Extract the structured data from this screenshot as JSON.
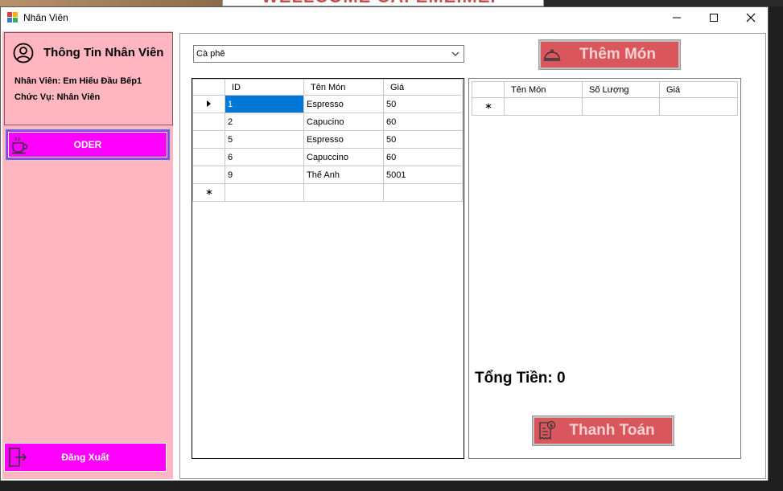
{
  "background_banner": "WELLCOME CAFEMEIMEI",
  "window": {
    "title": "Nhân Viên"
  },
  "sidebar": {
    "info_title": "Thông Tin Nhân Viên",
    "employee_line": "Nhân Viên: Em Hiếu Đầu Bếp1",
    "role_line": "Chức Vụ: Nhân Viên",
    "oder_label": "ODER",
    "logout_label": "Đăng Xuất"
  },
  "main": {
    "category_value": "Cà phê",
    "add_button_label": "Thêm Món",
    "menu_grid": {
      "columns": [
        "ID",
        "Tên Món",
        "Giá"
      ],
      "rows": [
        {
          "id": "1",
          "name": "Espresso",
          "price": "50"
        },
        {
          "id": "2",
          "name": "Capucino",
          "price": "60"
        },
        {
          "id": "5",
          "name": "Espresso",
          "price": "50"
        },
        {
          "id": "6",
          "name": "Capuccino",
          "price": "60"
        },
        {
          "id": "9",
          "name": "Thế Anh",
          "price": "5001"
        }
      ]
    },
    "order_grid": {
      "columns": [
        "Tên Món",
        "Số Lượng",
        "Giá"
      ]
    },
    "total_label": "Tổng Tiền: 0",
    "pay_button_label": "Thanh Toán"
  },
  "colors": {
    "sidebar_bg": "#ffb6c1",
    "magenta_button": "#ff00ff",
    "red_button": "#d9575c",
    "selection": "#0078d7"
  }
}
